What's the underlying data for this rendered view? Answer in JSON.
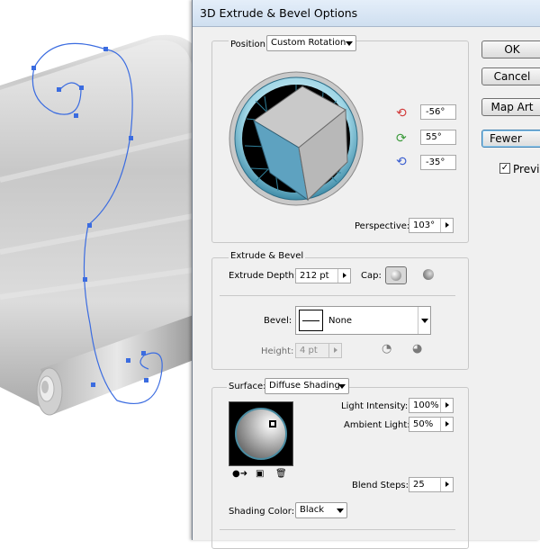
{
  "dialog": {
    "title": "3D Extrude & Bevel Options",
    "position": {
      "label": "Position:",
      "value": "Custom Rotation",
      "rotations": [
        "-56°",
        "55°",
        "-35°"
      ],
      "perspective_label": "Perspective:",
      "perspective_value": "103°"
    },
    "extrude": {
      "section_label": "Extrude & Bevel",
      "depth_label": "Extrude Depth:",
      "depth_value": "212 pt",
      "cap_label": "Cap:",
      "bevel_label": "Bevel:",
      "bevel_value": "None",
      "height_label": "Height:",
      "height_value": "4 pt"
    },
    "surface": {
      "label": "Surface:",
      "value": "Diffuse Shading",
      "light_intensity_label": "Light Intensity:",
      "light_intensity_value": "100%",
      "ambient_light_label": "Ambient Light:",
      "ambient_light_value": "50%",
      "blend_steps_label": "Blend Steps:",
      "blend_steps_value": "25",
      "shading_color_label": "Shading Color:",
      "shading_color_value": "Black"
    },
    "buttons": {
      "ok": "OK",
      "cancel": "Cancel",
      "map_art": "Map Art",
      "fewer_options": "Fewer Opt",
      "preview": "Previe"
    },
    "colors": {
      "accent": "#3c7fb1",
      "cube_front": "#5ea2c0",
      "cube_top": "#c9c9c9",
      "path": "#3b6ce0"
    }
  }
}
